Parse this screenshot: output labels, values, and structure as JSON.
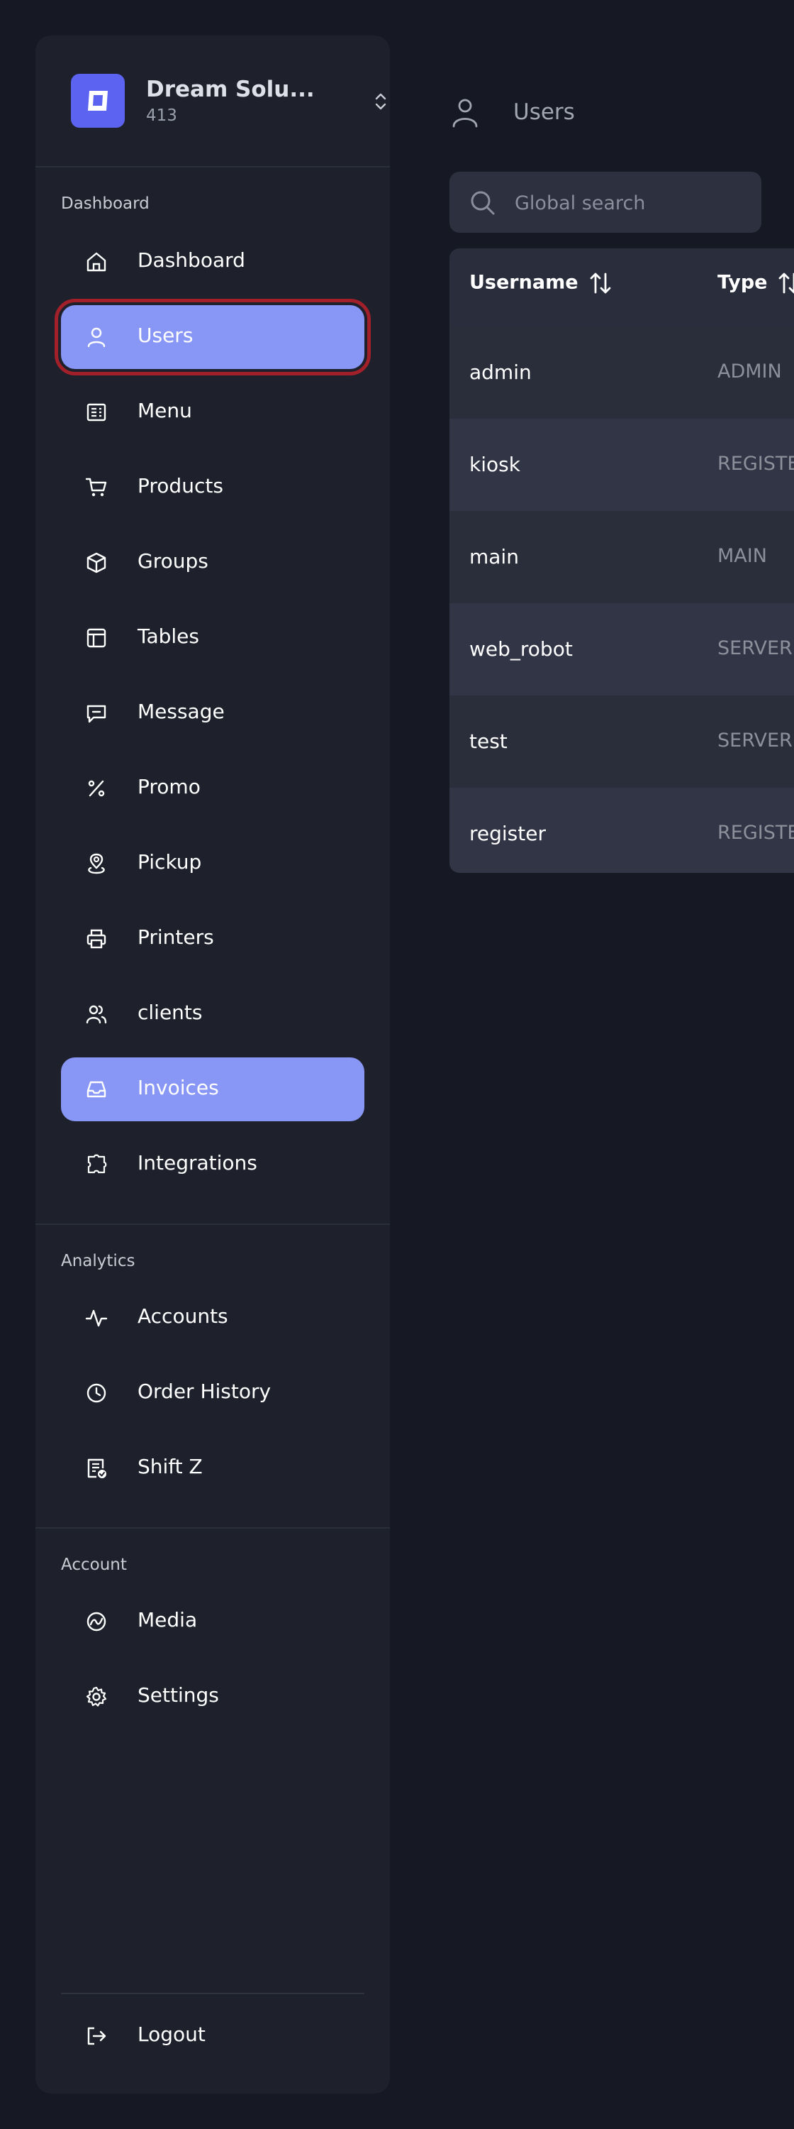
{
  "brand": {
    "name": "Dream Solu...",
    "sub": "413"
  },
  "sections": {
    "dashboard": "Dashboard",
    "analytics": "Analytics",
    "account": "Account"
  },
  "nav": {
    "dashboard": "Dashboard",
    "users": "Users",
    "menu": "Menu",
    "products": "Products",
    "groups": "Groups",
    "tables": "Tables",
    "message": "Message",
    "promo": "Promo",
    "pickup": "Pickup",
    "printers": "Printers",
    "clients": "clients",
    "invoices": "Invoices",
    "integrations": "Integrations",
    "accounts": "Accounts",
    "order_history": "Order History",
    "shift_z": "Shift Z",
    "media": "Media",
    "settings": "Settings",
    "logout": "Logout"
  },
  "header": {
    "title": "Users"
  },
  "search": {
    "placeholder": "Global search",
    "value": ""
  },
  "table": {
    "columns": {
      "username": "Username",
      "type": "Type"
    },
    "rows": [
      {
        "username": "admin",
        "type": "ADMIN"
      },
      {
        "username": "kiosk",
        "type": "REGISTE"
      },
      {
        "username": "main",
        "type": "MAIN"
      },
      {
        "username": "web_robot",
        "type": "SERVER"
      },
      {
        "username": "test",
        "type": "SERVER"
      },
      {
        "username": "register",
        "type": "REGISTE"
      }
    ]
  },
  "colors": {
    "background": "#161923",
    "sidebar": "#1e212b",
    "accent": "#8896f6",
    "brand": "#5b63f0",
    "focus_ring": "#a2202a"
  },
  "icons": {
    "dashboard": "home-icon",
    "users": "user-icon",
    "menu": "menu-list-icon",
    "products": "cart-icon",
    "groups": "box-icon",
    "tables": "table-layout-icon",
    "message": "message-icon",
    "promo": "percent-icon",
    "pickup": "location-pin-icon",
    "printers": "printer-icon",
    "clients": "users-icon",
    "invoices": "inbox-icon",
    "integrations": "puzzle-icon",
    "accounts": "activity-icon",
    "order_history": "clock-icon",
    "shift_z": "receipt-check-icon",
    "media": "gauge-icon",
    "settings": "gear-icon",
    "logout": "logout-icon"
  }
}
